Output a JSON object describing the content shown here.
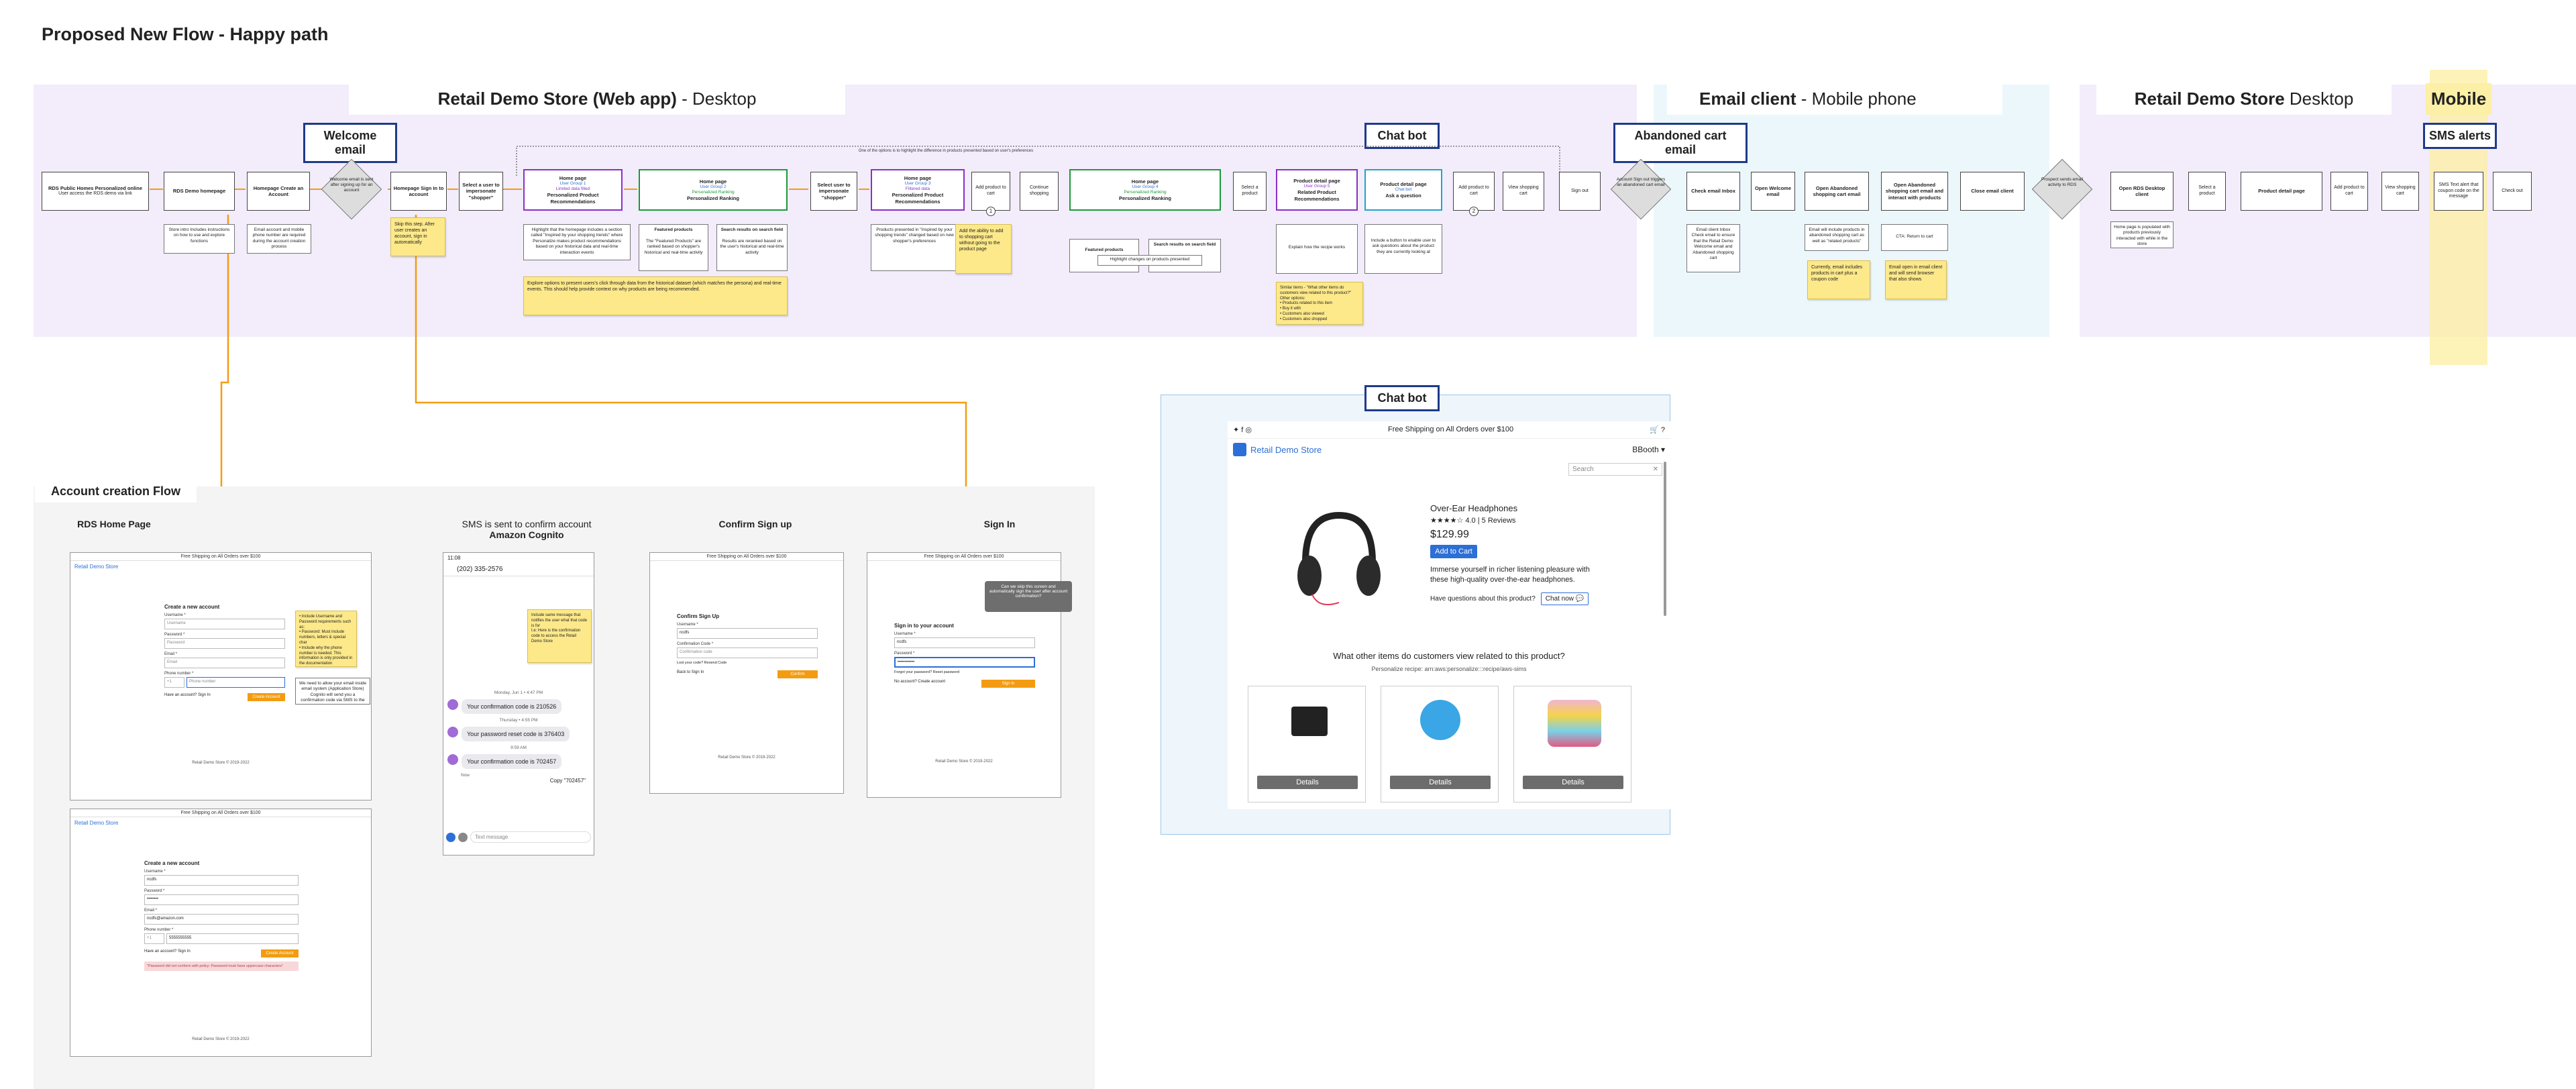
{
  "page_title": "Proposed New Flow - Happy path",
  "lanes": {
    "web_desktop": {
      "title_bold": "Retail Demo Store (Web app)",
      "title_rest": " - Desktop"
    },
    "email": {
      "title_bold": "Email client",
      "title_rest": " - Mobile phone"
    },
    "desktop2": {
      "title_bold": "Retail Demo Store",
      "title_rest": "  Desktop"
    },
    "mobile": {
      "title_bold": "Mobile",
      "title_rest": ""
    }
  },
  "tags": {
    "welcome_email": "Welcome email",
    "chat_bot": "Chat bot",
    "abandoned_cart_email": "Abandoned cart email",
    "sms_alerts": "SMS alerts",
    "chat_bot_panel": "Chat bot"
  },
  "flow": {
    "top_caption": "One of the options is to highlight the difference in products presented based on user's preferences",
    "b1": {
      "title": "RDS Public Homes Personalized online",
      "body": "User access the RDS demo via link"
    },
    "b2": {
      "title": "RDS Demo homepage",
      "body": ""
    },
    "b3": {
      "title": "Homepage Create an Account",
      "body": ""
    },
    "d1": "Welcome email is sent after signing up for an account",
    "b4": {
      "title": "Homepage Sign In to account",
      "body": ""
    },
    "b5": {
      "title": "Select a user to impersonate \"shopper\"",
      "body": ""
    },
    "b6": {
      "title": "Home page",
      "l1": "User Group 1",
      "l2": "Limited data filled",
      "t2": "Personalized Product Recommendations"
    },
    "b7": {
      "title": "Home page",
      "l1": "User Group 2",
      "l2": "Personalized Ranking",
      "t2": "Personalized Ranking"
    },
    "b8": {
      "title": "Select user to impersonate \"shopper\"",
      "body": ""
    },
    "b9": {
      "title": "Home page",
      "l1": "User Group 3",
      "l2": "Filtered data",
      "t2": "Personalized Product Recommendations"
    },
    "b10": {
      "title": "",
      "body": "Add product to cart"
    },
    "b11": {
      "title": "",
      "body": "Continue shopping"
    },
    "b12": {
      "title": "Home page",
      "l1": "User Group 4",
      "l2": "Personalized Ranking",
      "t2": "Personalized Ranking"
    },
    "b13": {
      "title": "",
      "body": "Select a product"
    },
    "b14": {
      "title": "Product detail page",
      "l1": "User Group 5",
      "t2": "Related Product Recommendations"
    },
    "b15": {
      "title": "Product detail page",
      "l1": "Chat bot",
      "t2": "Ask a question"
    },
    "b16": {
      "title": "",
      "body": "Add product to cart"
    },
    "b17": {
      "title": "",
      "body": "View shopping cart"
    },
    "b18": {
      "title": "",
      "body": "Sign out"
    },
    "d2": "Account Sign out triggers an abandoned cart email",
    "b19": {
      "title": "Check email Inbox",
      "body": ""
    },
    "b20": {
      "title": "Open Welcome email",
      "body": ""
    },
    "b21": {
      "title": "Open Abandoned shopping cart email",
      "body": ""
    },
    "b22": {
      "title": "Open Abandoned shopping cart email and interact with products",
      "body": ""
    },
    "b23": {
      "title": "Close email client",
      "body": ""
    },
    "d3": "Prospect sends email activity to RDS",
    "b24": {
      "title": "Open RDS Desktop client",
      "body": ""
    },
    "b25": {
      "title": "",
      "body": "Select a product"
    },
    "b26": {
      "title": "Product detail page",
      "body": ""
    },
    "b27": {
      "title": "",
      "body": "Add product to cart"
    },
    "b28": {
      "title": "",
      "body": "View shopping cart"
    },
    "b29": {
      "title": "",
      "body": "SMS Text alert that coupon code on the message"
    },
    "b30": {
      "title": "",
      "body": "Check out"
    },
    "n1": "Store intro Includes instructions on how to use and explore functions",
    "n2": "Email account and mobile phone number are required during the account creation process",
    "n3": "Highlight that the homepage includes a section called \"Inspired by your shopping trends\" where Personalize makes product recommendations based on your historical data and real-time interaction events",
    "n4": "Featured products",
    "n4b": "The \"Featured Products\" are ranked based on shopper's historical and real-time activity",
    "n5": "Search results on search field",
    "n5b": "Results are reranked based on the user's historical and real-time activity",
    "n6": "Products presented in \"Inspired by your shopping trends\" changed based on new shopper's preferences",
    "n7": "Featured products",
    "n8": "Search results on search field",
    "n8b": "Highlight changes on products presented",
    "n9": "Explain how the recipe works",
    "n10": "Include a button to enable user to ask questions about the product they are currently looking at",
    "n11": "Email client Inbox Check email to ensure that the Retail Demo Welcome email and Abandoned shopping cart",
    "n12": "Email will include products in abandoned shopping cart as well as \"related products\"",
    "n13": "CTA: Return to cart",
    "n14": "Home page is populated with products previously interacted with while in the store",
    "s1": "Skip this step. After user creates an account, sign in automatically",
    "s2": "Explore options to present users's click through data from the historical dataset (which matches the persona) and real-time events. This should help provide context on why products are being recommended.",
    "s3": "Add the ability to add to shopping cart without going to the product page",
    "s4": "Similar items - \"What other items do customers view related to this product?\"\nOther options:\n• Products related to this item\n• Buy it with\n• Customers also viewed\n• Customers also shopped",
    "s5": "Currently, email includes products in cart plus a coupon code",
    "s6": "Email open in email client and will send browser that also shows",
    "c1": "1",
    "c2": "2"
  },
  "account_flow": {
    "title": "Account creation Flow",
    "screens": {
      "home": "RDS Home Page",
      "sms_line1": "SMS is sent to confirm account",
      "sms_line2": "Amazon Cognito",
      "confirm": "Confirm Sign up",
      "signin": "Sign In"
    },
    "shipping_banner": "Free Shipping on All Orders over $100",
    "brand": "Retail Demo Store",
    "create_account": "Create a new account",
    "username_lbl": "Username *",
    "username_ph": "Username",
    "password_lbl": "Password *",
    "password_ph": "Password",
    "email_lbl": "Email *",
    "email_ph": "Email",
    "phone_lbl": "Phone number *",
    "phone_code": "+1",
    "phone_ph": "Phone number",
    "create_btn": "Create Account",
    "have_account": "Have an account? Sign In",
    "footer": "Retail Demo Store © 2019-2022",
    "user_value": "ncdfs",
    "email_value": "ncdfs@amazon.com",
    "phone_value": "5555555555",
    "error": "\"Password did not conform with policy: Password must have uppercase characters\"",
    "sticky_home": "• Include Username and Password requirements such as:\n• Password: Must include numbers, letters & special char\n• Include why the phone number is needed. This information is only provided in the documentation",
    "note_home": "We need to allow your email inside email system (Application Store) Cognito will send you a confirmation code via SMS to the your mobile phone",
    "sms_time_top": "11:08",
    "sms_number": "(202) 335-2576",
    "sms_date1": "Monday, Jun 1 • 4:47 PM",
    "msg1": "Your confirmation code is 210526",
    "sms_date2": "Thursday • 4:55 PM",
    "msg2": "Your password reset code is 376403",
    "sms_date3": "9:59 AM",
    "msg3": "Your confirmation code is 702457",
    "sms_now": "Now",
    "copy_label": "Copy \"702457\"",
    "text_ph": "Text message",
    "sticky_sms": "Include same message that notifies the user what that code is for\nI.e: Here is the confirmation code to access the Retail Demo Store",
    "confirm_heading": "Confirm Sign Up",
    "confirm_user": "ncdfs",
    "confirm_code_lbl": "Confirmation Code *",
    "confirm_code_ph": "Confirmation code",
    "resend": "Lost your code? Resend Code",
    "back": "Back to Sign In",
    "confirm_btn": "Confirm",
    "signin_heading": "Sign in to your account",
    "signin_user": "ncdfs",
    "signin_pwd": "••••••••••••",
    "forgot": "Forgot your password? Reset password",
    "no_account": "No account? Create account",
    "signin_btn": "Sign In",
    "tooltip": "Can we skip this screen and automatically sign the user after account confirmation?"
  },
  "chatbot_panel": {
    "banner": "Free Shipping on All Orders over $100",
    "brand": "Retail Demo Store",
    "user": "BBooth",
    "search_ph": "Search",
    "product_name": "Over-Ear Headphones",
    "rating": "4.0",
    "reviews": "5 Reviews",
    "price": "$129.99",
    "add_to_cart": "Add to Cart",
    "desc": "Immerse yourself in richer listening pleasure with these high-quality over-the-ear headphones.",
    "questions": "Have questions about this product?",
    "chat_now": "Chat now",
    "also_title": "What other items do customers view related to this product?",
    "recipe": "Personalize recipe: arn:aws:personalize:::recipe/aws-sims",
    "details1": "Details",
    "details2": "Details",
    "details3": "Details"
  },
  "colors": {
    "lane_purple": "#f2ecfb",
    "lane_blue": "#ecf7fb",
    "account_bg": "#f4f4f4",
    "tag_border": "#1f3a8a",
    "orange_line": "#f39c12",
    "sticky": "#fde98a",
    "brand_blue": "#2c6fd6"
  }
}
